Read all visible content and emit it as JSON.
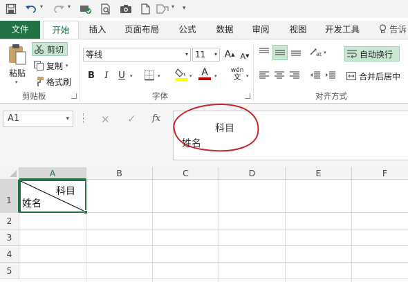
{
  "colors": {
    "excel_green": "#217346",
    "annotation_red": "#c0282c"
  },
  "quick_access": {
    "icons": [
      "save-icon",
      "undo-icon",
      "redo-icon",
      "touch-mode-icon",
      "print-preview-icon",
      "camera-icon",
      "new-document-icon",
      "shapes-icon",
      "customize-icon"
    ]
  },
  "tabs": [
    {
      "label": "文件"
    },
    {
      "label": "开始"
    },
    {
      "label": "插入"
    },
    {
      "label": "页面布局"
    },
    {
      "label": "公式"
    },
    {
      "label": "数据"
    },
    {
      "label": "审阅"
    },
    {
      "label": "视图"
    },
    {
      "label": "开发工具"
    },
    {
      "label": "告诉"
    }
  ],
  "clipboard": {
    "paste": "粘贴",
    "cut": "剪切",
    "copy": "复制",
    "format_painter": "格式刷",
    "group": "剪贴板"
  },
  "font": {
    "name": "等线",
    "size": "11",
    "grow": "A",
    "shrink": "A",
    "bold": "B",
    "italic": "I",
    "underline": "U",
    "font_color": "A",
    "phonetic": "wén",
    "group": "字体"
  },
  "alignment": {
    "wrap_text": "自动换行",
    "merge_center": "合并后居中",
    "group": "对齐方式"
  },
  "formula_bar": {
    "name_box": "A1",
    "fx": "fx",
    "line1": "科目",
    "line2": "姓名"
  },
  "grid": {
    "columns": [
      "A",
      "B",
      "C",
      "D",
      "E",
      "F"
    ],
    "rows": [
      "1",
      "2",
      "3",
      "4",
      "5"
    ],
    "a1_top": "科目",
    "a1_bottom": "姓名"
  }
}
